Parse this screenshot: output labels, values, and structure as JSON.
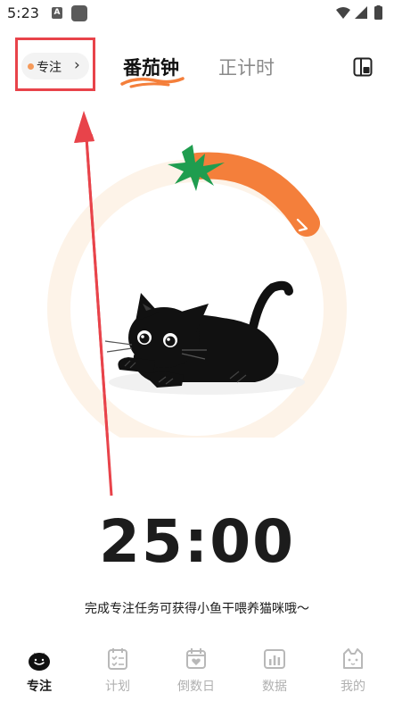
{
  "status_bar": {
    "time": "5:23",
    "a_badge": "A",
    "icons": [
      "wifi-icon",
      "signal-icon",
      "battery-icon"
    ]
  },
  "header": {
    "focus_chip": {
      "label": "专注",
      "chevron": "›",
      "dot_color": "#f59a5a"
    },
    "tabs": [
      {
        "label": "番茄钟",
        "active": true
      },
      {
        "label": "正计时",
        "active": false
      }
    ],
    "right_icon": "layout-switch-icon"
  },
  "timer": {
    "time_display": "25:00",
    "tip": "完成专注任务可获得小鱼干喂养猫咪哦～",
    "progress_arc_color": "#f47f3b",
    "ring_color": "#fdf3e8",
    "leaf_color": "#1f9d4f"
  },
  "bottom_nav": {
    "items": [
      {
        "label": "专注",
        "icon": "tomato-icon",
        "active": true
      },
      {
        "label": "计划",
        "icon": "checklist-icon",
        "active": false
      },
      {
        "label": "倒数日",
        "icon": "calendar-heart-icon",
        "active": false
      },
      {
        "label": "数据",
        "icon": "bar-chart-icon",
        "active": false
      },
      {
        "label": "我的",
        "icon": "cat-face-icon",
        "active": false
      }
    ]
  }
}
